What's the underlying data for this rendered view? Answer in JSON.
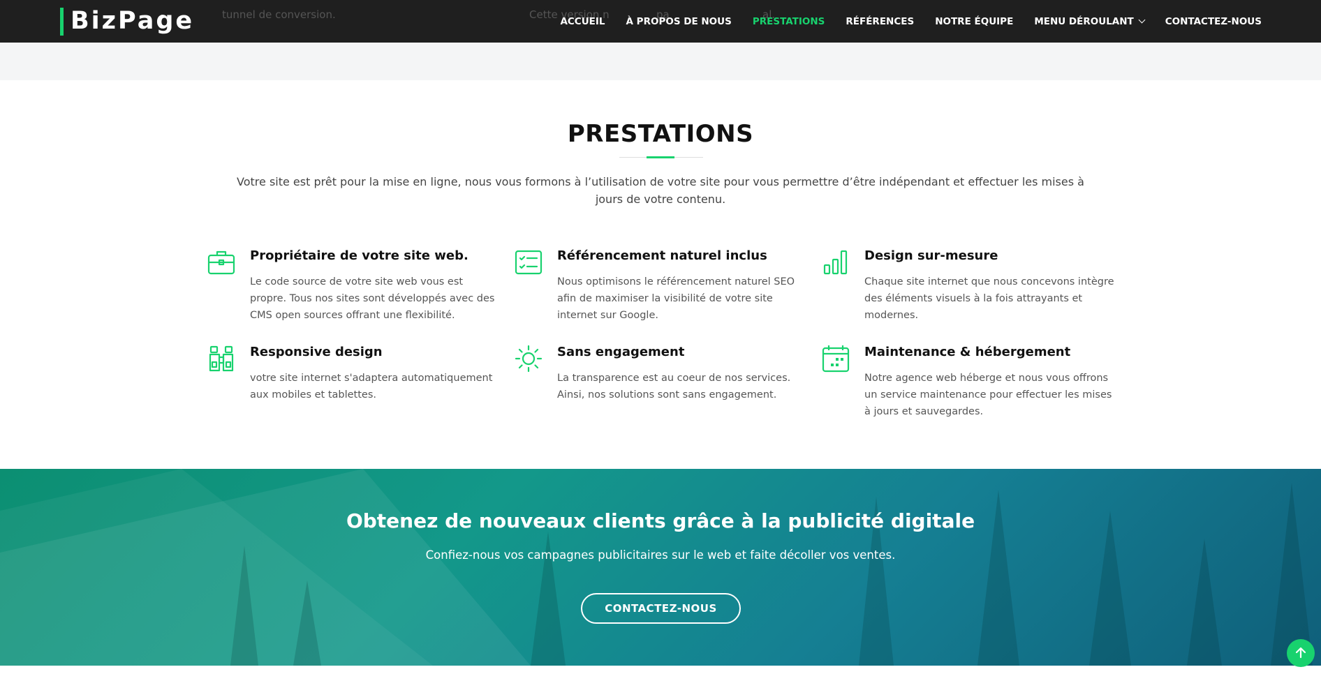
{
  "header": {
    "logo": "BizPage",
    "nav": [
      {
        "label": "ACCUEIL"
      },
      {
        "label": "À PROPOS DE NOUS"
      },
      {
        "label": "PRESTATIONS"
      },
      {
        "label": "RÉFÉRENCES"
      },
      {
        "label": "NOTRE ÉQUIPE"
      },
      {
        "label": "MENU DÉROULANT"
      },
      {
        "label": "CONTACTEZ-NOUS"
      }
    ],
    "active_nav": "PRESTATIONS",
    "behind_text": [
      "tunnel de conversion.",
      "Cette version n",
      "pa",
      "al."
    ]
  },
  "services": {
    "title": "PRESTATIONS",
    "description": "Votre site est prêt pour la mise en ligne, nous vous formons à l’utilisation de votre site pour vous permettre d’être indépendant et effectuer les mises à jours de votre contenu.",
    "items": [
      {
        "icon": "briefcase-icon",
        "title": "Propriétaire de votre site web.",
        "text": "Le code source de votre site web vous est propre. Tous nos sites sont développés avec des CMS open sources offrant une flexibilité."
      },
      {
        "icon": "card-checklist-icon",
        "title": "Référencement naturel inclus",
        "text": "Nous optimisons le référencement naturel SEO afin de maximiser la visibilité de votre site internet sur Google."
      },
      {
        "icon": "bar-chart-icon",
        "title": "Design sur-mesure",
        "text": "Chaque site internet que nous concevons intègre des éléments visuels à la fois attrayants et modernes."
      },
      {
        "icon": "binoculars-icon",
        "title": "Responsive design",
        "text": "votre site internet s'adaptera automatiquement aux mobiles et tablettes."
      },
      {
        "icon": "sun-icon",
        "title": "Sans engagement",
        "text": "La transparence est au coeur de nos services. Ainsi, nos solutions sont sans engagement."
      },
      {
        "icon": "calendar-icon",
        "title": "Maintenance & hébergement",
        "text": "Notre agence web héberge et nous vous offrons un service maintenance pour effectuer les mises à jours et sauvegardes."
      }
    ]
  },
  "cta": {
    "title": "Obtenez de nouveaux clients grâce à la publicité digitale",
    "text": "Confiez-nous vos campagnes publicitaires sur le web et faite décoller vos ventes.",
    "button": "CONTACTEZ-NOUS"
  },
  "colors": {
    "accent": "#18d26e",
    "header_bg": "#111111",
    "cta_gradient_start": "#0c8f72",
    "cta_gradient_end": "#0f5f7a"
  },
  "back_to_top": {
    "icon": "arrow-up-icon"
  }
}
